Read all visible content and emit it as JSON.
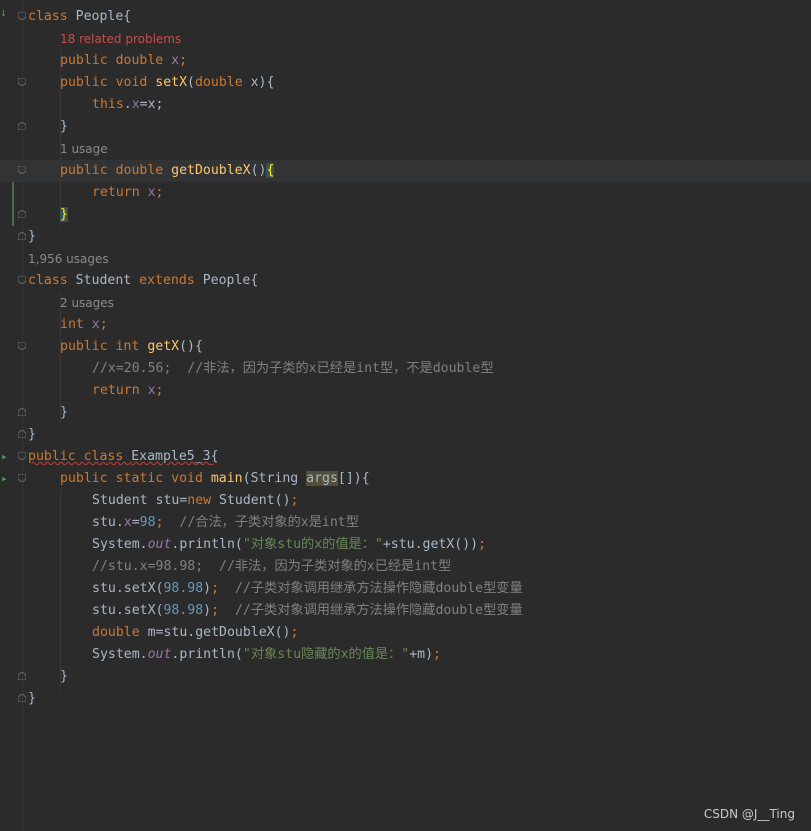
{
  "editor": {
    "language": "java",
    "hints": {
      "related_problems": "18 related problems",
      "one_usage": "1 usage",
      "many_usages": "1,956 usages",
      "two_usages": "2 usages"
    },
    "lines": {
      "l1_a": "class ",
      "l1_b": "People{",
      "l2_a": "public double ",
      "l2_b": "x",
      "l2_c": ";",
      "l3_a": "public void ",
      "l3_b": "setX",
      "l3_c": "(",
      "l3_d": "double ",
      "l3_e": "x){",
      "l4_a": "this",
      "l4_b": ".",
      "l4_c": "x",
      "l4_d": "=x;",
      "l5": "}",
      "l6_a": "public double ",
      "l6_b": "getDoubleX",
      "l6_c": "()",
      "l6_d": "{",
      "l7_a": "return ",
      "l7_b": "x",
      "l7_c": ";",
      "l8": "}",
      "l9": "}",
      "l10_a": "class ",
      "l10_b": "Student ",
      "l10_c": "extends ",
      "l10_d": "People{",
      "l11_a": "int ",
      "l11_b": "x",
      "l11_c": ";",
      "l12_a": "public int ",
      "l12_b": "getX",
      "l12_c": "(){",
      "l13": "//x=20.56;  //非法，因为子类的x已经是int型，不是double型",
      "l14_a": "return ",
      "l14_b": "x",
      "l14_c": ";",
      "l15": "}",
      "l16": "}",
      "l17_a": "public class ",
      "l17_b": "Example5_3",
      "l17_c": "{",
      "l18_a": "public static void ",
      "l18_b": "main",
      "l18_c": "(String ",
      "l18_d": "args",
      "l18_e": "[]){",
      "l19_a": "Student stu=",
      "l19_b": "new ",
      "l19_c": "Student()",
      "l19_d": ";",
      "l20_a": "stu.",
      "l20_b": "x",
      "l20_c": "=",
      "l20_d": "98",
      "l20_e": ";  ",
      "l20_f": "//合法，子类对象的x是int型",
      "l21_a": "System.",
      "l21_b": "out",
      "l21_c": ".println(",
      "l21_d": "\"对象stu的x的值是：\"",
      "l21_e": "+stu.getX())",
      "l21_f": ";",
      "l22": "//stu.x=98.98;  //非法，因为子类对象的x已经是int型",
      "l23_a": "stu.setX(",
      "l23_b": "98.98",
      "l23_c": ")",
      "l23_d": ";  ",
      "l23_e": "//子类对象调用继承方法操作隐藏double型变量",
      "l24_a": "stu.setX(",
      "l24_b": "98.98",
      "l24_c": ")",
      "l24_d": ";  ",
      "l24_e": "//子类对象调用继承方法操作隐藏double型变量",
      "l25_a": "double ",
      "l25_b": "m=stu.getDoubleX()",
      "l25_c": ";",
      "l26_a": "System.",
      "l26_b": "out",
      "l26_c": ".println(",
      "l26_d": "\"对象stu隐藏的x的值是：\"",
      "l26_e": "+m)",
      "l26_f": ";",
      "l27": "}",
      "l28": "}"
    }
  },
  "watermark": "CSDN @J__Ting",
  "colors": {
    "background": "#2b2b2b",
    "keyword": "#cc7832",
    "method": "#ffc66d",
    "field": "#9876aa",
    "number": "#6897bb",
    "string": "#6a8759",
    "comment": "#808080"
  }
}
